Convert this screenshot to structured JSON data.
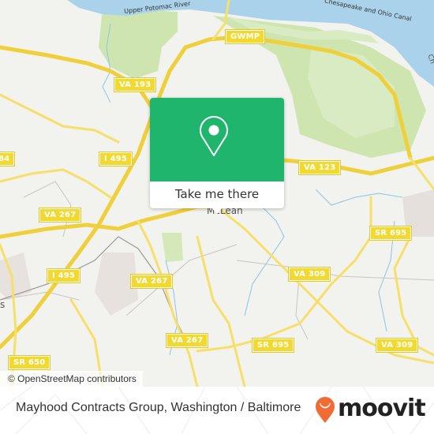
{
  "map": {
    "colors": {
      "land": "#f2f2ee",
      "water": "#aad3eb",
      "park": "#cfe5b0",
      "road": "#f5dc4e",
      "popup_green": "#1fb56c",
      "brand_orange": "#f26a34"
    },
    "water_labels": {
      "river": "Upper Potomac River",
      "canal": "Chesapeake and Ohio Canal"
    },
    "places": {
      "mclean": "McLean",
      "partial_left": "s",
      "partial_right": "Ch"
    },
    "shields": {
      "gwmp": "GWMP",
      "va193": "VA 193",
      "i495_top": "I 495",
      "va123": "VA 123",
      "va267_left": "VA 267",
      "sr695_right": "SR 695",
      "i495_bottom": "I 495",
      "va267_mid": "VA 267",
      "va309_mid": "VA 309",
      "va267_low": "VA 267",
      "sr695_low": "SR 695",
      "va309_right": "VA 309",
      "sr650": "SR 650",
      "partial_84": "84"
    }
  },
  "popup": {
    "icon": "map-pin-icon",
    "button_label": "Take me there"
  },
  "attribution": "© OpenStreetMap contributors",
  "footer": {
    "title": "Mayhood Contracts Group, Washington / Baltimore",
    "brand": "moovit",
    "brand_icon": "moovit-pin-logo-icon"
  }
}
